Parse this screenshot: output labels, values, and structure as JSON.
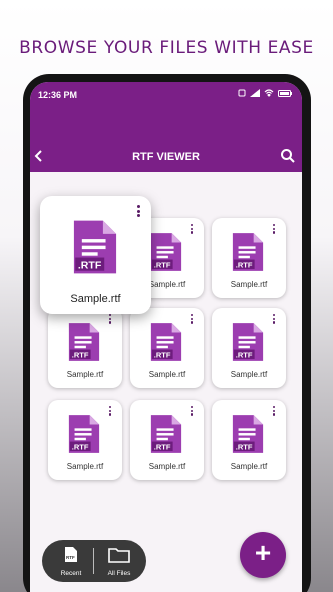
{
  "headline": "BROWSE YOUR FILES WITH EASE",
  "status": {
    "time": "12:36 PM"
  },
  "app_bar": {
    "title": "RTF VIEWER"
  },
  "file_badge": ".RTF",
  "files": [
    {
      "name": "Sample.rtf"
    },
    {
      "name": "Sample.rtf"
    },
    {
      "name": "Sample.rtf"
    },
    {
      "name": "Sample.rtf"
    },
    {
      "name": "Sample.rtf"
    },
    {
      "name": "Sample.rtf"
    },
    {
      "name": "Sample.rtf"
    },
    {
      "name": "Sample.rtf"
    },
    {
      "name": "Sample.rtf"
    }
  ],
  "bottom_nav": {
    "recent_label": "Recent",
    "all_files_label": "All Files",
    "recent_badge": "RTF"
  },
  "fab": {
    "label": "+"
  },
  "colors": {
    "primary": "#7b1f87",
    "headline": "#6a1b7a",
    "icon": "#9c3db0"
  }
}
